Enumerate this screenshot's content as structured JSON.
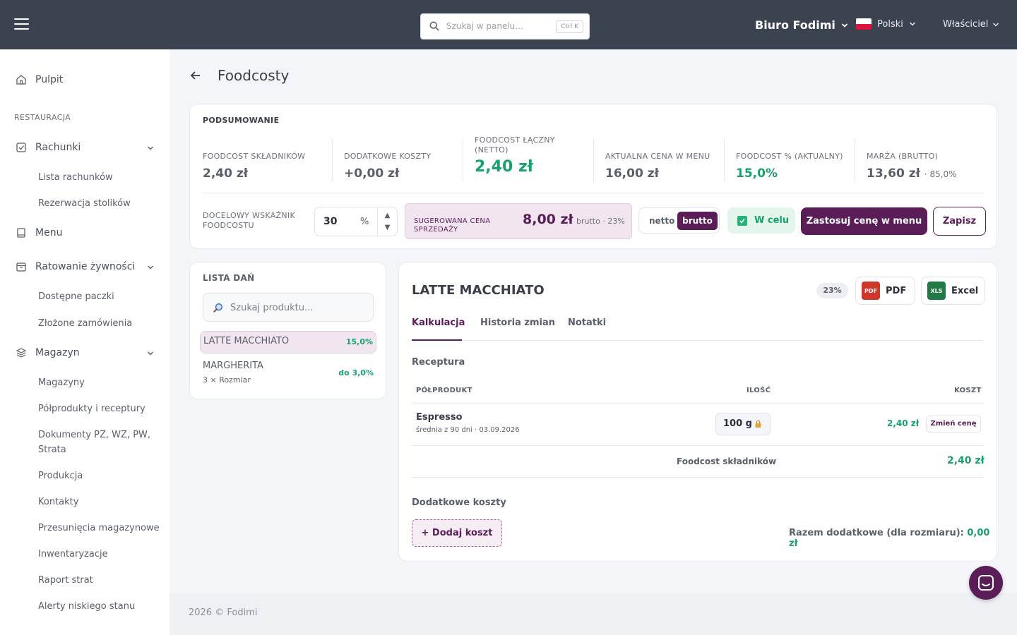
{
  "topbar": {
    "search_placeholder": "Szukaj w panelu...",
    "search_shortcut": "Ctrl K",
    "company": "Biuro Fodimi",
    "language": "Polski",
    "user_role": "Właściciel"
  },
  "sidebar": {
    "dashboard": "Pulpit",
    "section_restaurant": "RESTAURACJA",
    "bills": "Rachunki",
    "bills_list": "Lista rachunków",
    "table_reservation": "Rezerwacja stolików",
    "menu": "Menu",
    "food_rescue": "Ratowanie żywności",
    "available_packages": "Dostępne paczki",
    "placed_orders": "Złożone zamówienia",
    "warehouse": "Magazyn",
    "warehouses": "Magazyny",
    "semi_products": "Półprodukty i receptury",
    "documents": "Dokumenty PZ, WZ, PW, Strata",
    "production": "Produkcja",
    "contacts": "Kontakty",
    "stock_transfers": "Przesunięcia magazynowe",
    "inventory": "Inwentaryzacje",
    "loss_report": "Raport strat",
    "low_stock_alerts": "Alerty niskiego stanu"
  },
  "page": {
    "title": "Foodcosty"
  },
  "summary": {
    "heading": "PODSUMOWANIE",
    "metrics": [
      {
        "label": "FOODCOST SKŁADNIKÓW",
        "value": "2,40 zł"
      },
      {
        "label": "DODATKOWE KOSZTY",
        "value": "+0,00 zł"
      },
      {
        "label": "FOODCOST ŁĄCZNY (NETTO)",
        "value": "2,40 zł"
      },
      {
        "label": "AKTUALNA CENA W MENU",
        "value": "16,00 zł"
      },
      {
        "label": "FOODCOST % (AKTUALNY)",
        "value": "15,0%"
      },
      {
        "label": "MARŻA (BRUTTO)",
        "value": "13,60 zł",
        "extra": "· 85,0%"
      }
    ],
    "target_label": "DOCELOWY WSKAŹNIK FOODCOSTU",
    "target_value": "30",
    "target_unit": "%",
    "suggested_label": "SUGEROWANA CENA SPRZEDAŻY",
    "suggested_value": "8,00 zł",
    "suggested_suffix": "brutto · 23%",
    "toggle_netto": "netto",
    "toggle_brutto": "brutto",
    "goal_badge": "W celu",
    "apply_button": "Zastosuj cenę w menu",
    "save_button": "Zapisz"
  },
  "dish_list": {
    "title": "LISTA DAŃ",
    "search_placeholder": "Szukaj produktu...",
    "items": [
      {
        "name": "LATTE MACCHIATO",
        "percent": "15,0%"
      },
      {
        "name": "MARGHERITA",
        "sub": "3 × Rozmiar",
        "percent": "do 3,0%"
      }
    ]
  },
  "detail": {
    "title": "LATTE MACCHIATO",
    "vat": "23%",
    "pdf_button": "PDF",
    "excel_button": "Excel",
    "pdf_icon_text": "PDF",
    "excel_icon_text": "XLS",
    "tabs": [
      "Kalkulacja",
      "Historia zmian",
      "Notatki"
    ],
    "recipe_title": "Receptura",
    "col_semi": "PÓŁPRODUKT",
    "col_qty": "ILOŚĆ",
    "col_cost": "KOSZT",
    "row": {
      "name": "Espresso",
      "sub": "średnia z 90 dni · 03.09.2026",
      "qty": "100 g",
      "cost": "2,40 zł",
      "change_button": "Zmień cenę"
    },
    "total_label": "Foodcost składników",
    "total_value": "2,40 zł",
    "extra_title": "Dodatkowe koszty",
    "add_cost_button": "+ Dodaj koszt",
    "extra_total_label": "Razem dodatkowe (dla rozmiaru):",
    "extra_total_value": "0,00 zł"
  },
  "footer": {
    "text": "2026 © Fodimi"
  },
  "colors": {
    "primary": "#5b1d57",
    "green": "#17a26b",
    "topbar": "#3c4350"
  }
}
